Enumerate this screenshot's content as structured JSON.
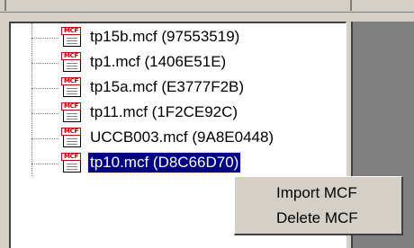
{
  "tree": {
    "items": [
      {
        "label": "tp15b.mcf (97553519)",
        "icon": "mcf-file-icon",
        "icon_tag": "MCF",
        "selected": false
      },
      {
        "label": "tp1.mcf (1406E51E)",
        "icon": "mcf-file-icon",
        "icon_tag": "MCF",
        "selected": false
      },
      {
        "label": "tp15a.mcf (E3777F2B)",
        "icon": "mcf-file-icon",
        "icon_tag": "MCF",
        "selected": false
      },
      {
        "label": "tp11.mcf (1F2CE92C)",
        "icon": "mcf-file-icon",
        "icon_tag": "MCF",
        "selected": false
      },
      {
        "label": "UCCB003.mcf (9A8E0448)",
        "icon": "mcf-file-icon",
        "icon_tag": "MCF",
        "selected": false
      },
      {
        "label": "tp10.mcf (D8C66D70)",
        "icon": "mcf-file-icon",
        "icon_tag": "MCF",
        "selected": true
      }
    ]
  },
  "context_menu": {
    "items": [
      {
        "label": "Import MCF"
      },
      {
        "label": "Delete MCF"
      }
    ]
  },
  "colors": {
    "selection_bg": "#000080",
    "selection_text": "#ffffff",
    "icon_tag": "#c00000",
    "window_bg": "#d4d0c8"
  }
}
